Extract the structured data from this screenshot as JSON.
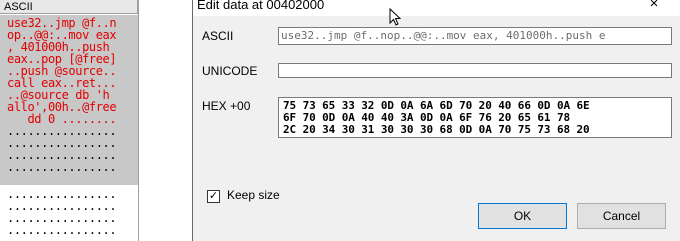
{
  "ascii_pane": {
    "header": "ASCII",
    "lines": [
      "use32..jmp @f..n",
      "op..@@:..mov eax",
      ", 401000h..push",
      "eax..pop [@free]",
      "..push @source..",
      "call eax..ret...",
      "..@source db 'h",
      "allo',00h..@free",
      "   dd 0 ........"
    ],
    "dot_lines": [
      "................",
      "................",
      "................",
      "................"
    ],
    "lower_dots": [
      "................",
      "................",
      "................",
      "................"
    ]
  },
  "dialog": {
    "title": "Edit data at 00402000",
    "close_icon": "×",
    "ascii_label": "ASCII",
    "ascii_value": "use32..jmp @f..nop..@@:..mov eax, 401000h..push e",
    "unicode_label": "UNICODE",
    "unicode_value": "",
    "hex_label": "HEX +00",
    "hex_lines": [
      "75 73 65 33 32 0D 0A 6A 6D 70 20 40 66 0D 0A 6E",
      "6F 70 0D 0A 40 40 3A 0D 0A 6F 76 20 65 61 78",
      "2C 20 34 30 31 30 30 30 68 0D 0A 70 75 73 68 20"
    ],
    "keep_size_checked": "✓",
    "keep_size_label": "Keep size",
    "ok_label": "OK",
    "cancel_label": "Cancel"
  }
}
